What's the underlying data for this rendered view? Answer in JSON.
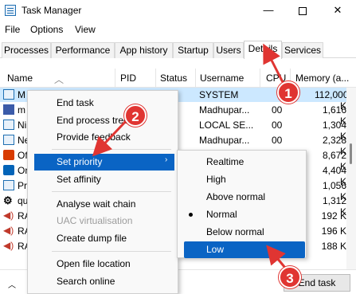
{
  "window": {
    "title": "Task Manager",
    "minimize": "—",
    "close": "✕"
  },
  "menu": [
    "File",
    "Options",
    "View"
  ],
  "tabs": [
    "Processes",
    "Performance",
    "App history",
    "Startup",
    "Users",
    "Details",
    "Services"
  ],
  "active_tab": "Details",
  "columns": {
    "name": "Name",
    "pid": "PID",
    "status": "Status",
    "username": "Username",
    "cpu": "CPU",
    "memory": "Memory (a..."
  },
  "rows": [
    {
      "name": "M",
      "user": "SYSTEM",
      "cpu": "",
      "mem": "112,000 K",
      "icon": "app-icon"
    },
    {
      "name": "m",
      "user": "Madhupar...",
      "cpu": "00",
      "mem": "1,616 K",
      "icon": "ms-icon"
    },
    {
      "name": "Ni",
      "user": "LOCAL SE...",
      "cpu": "00",
      "mem": "1,304 K",
      "icon": "app-icon"
    },
    {
      "name": "Ne",
      "user": "Madhupar...",
      "cpu": "00",
      "mem": "2,328 K",
      "icon": "app-icon"
    },
    {
      "name": "Of",
      "user": "",
      "cpu": "",
      "mem": "8,672 K",
      "icon": "office-icon"
    },
    {
      "name": "Or",
      "user": "",
      "cpu": "",
      "mem": "4,404 K",
      "icon": "office-icon"
    },
    {
      "name": "Pr",
      "user": "",
      "cpu": "",
      "mem": "1,056 K",
      "icon": "app-icon"
    },
    {
      "name": "qu",
      "user": "",
      "cpu": "",
      "mem": "1,312 K",
      "icon": "gear-icon"
    },
    {
      "name": "RA",
      "user": "",
      "cpu": "",
      "mem": "192 K",
      "icon": "speaker-icon"
    },
    {
      "name": "RA",
      "user": "",
      "cpu": "",
      "mem": "196 K",
      "icon": "speaker-icon"
    },
    {
      "name": "RA",
      "user": "",
      "cpu": "",
      "mem": "188 K",
      "icon": "speaker-icon"
    }
  ],
  "context_menu": {
    "items": [
      "End task",
      "End process tree",
      "Provide feedback",
      "Set priority",
      "Set affinity",
      "Analyse wait chain",
      "UAC virtualisation",
      "Create dump file",
      "Open file location",
      "Search online"
    ],
    "highlighted": "Set priority",
    "disabled": "UAC virtualisation"
  },
  "priority_menu": {
    "items": [
      "Realtime",
      "High",
      "Above normal",
      "Normal",
      "Below normal",
      "Low"
    ],
    "selected": "Normal",
    "highlighted": "Low"
  },
  "bottom": {
    "end_task_button": "End task"
  },
  "callouts": [
    "1",
    "2",
    "3"
  ],
  "colors": {
    "highlight": "#0a64c4",
    "selected_row": "#cce8ff",
    "callout": "#e03532"
  }
}
